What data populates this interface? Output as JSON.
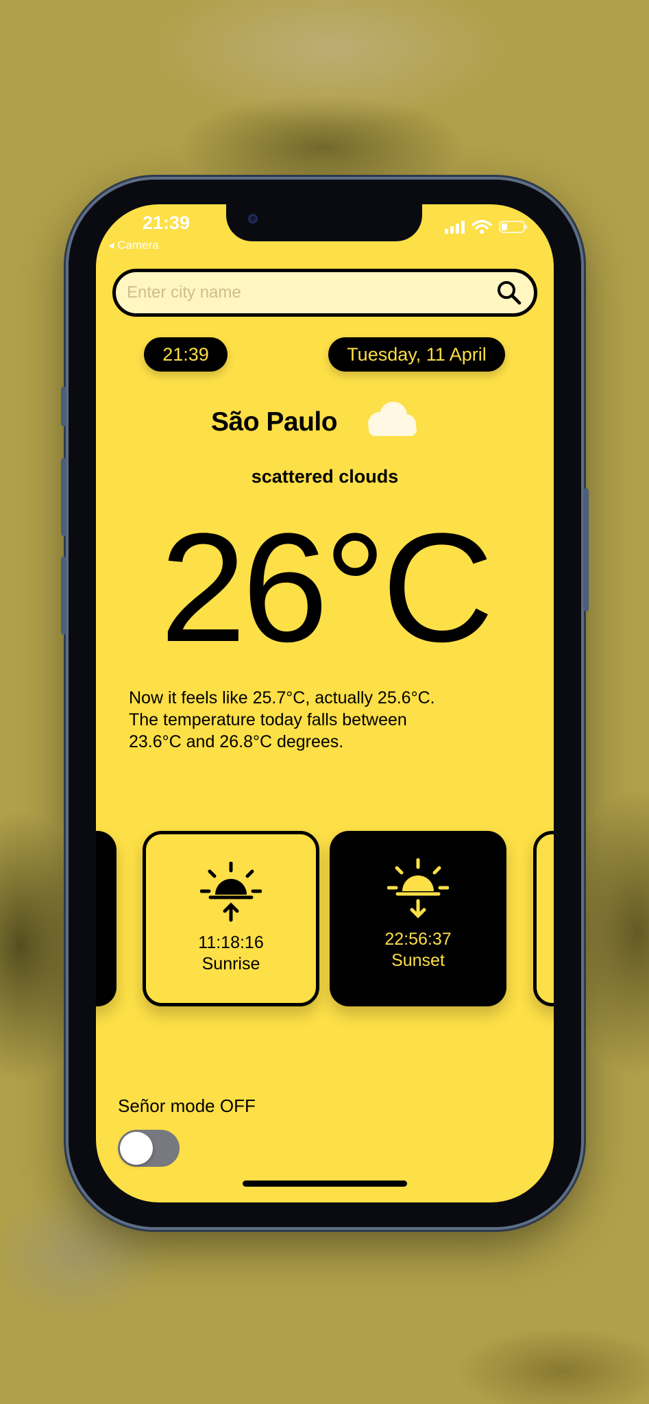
{
  "status_bar": {
    "time": "21:39",
    "back_label": "◂ Camera"
  },
  "search": {
    "placeholder": "Enter city name",
    "value": ""
  },
  "clock": {
    "time": "21:39",
    "date": "Tuesday, 11 April"
  },
  "weather": {
    "city": "São Paulo",
    "condition_icon": "cloud-icon",
    "description": "scattered clouds",
    "temperature": "26°C",
    "details": [
      "Now it feels like 25.7°C, actually 25.6°C.",
      "The temperature today falls between",
      "23.6°C and 26.8°C degrees."
    ]
  },
  "cards": [
    {
      "time": "11:18:16",
      "label": "Sunrise",
      "icon": "sunrise-icon",
      "style": "light"
    },
    {
      "time": "22:56:37",
      "label": "Sunset",
      "icon": "sunset-icon",
      "style": "dark"
    }
  ],
  "senor_mode": {
    "label": "Señor mode OFF",
    "on": false
  },
  "colors": {
    "accent": "#fddf47",
    "ink": "#000000",
    "search_bg": "#fff6c2"
  }
}
